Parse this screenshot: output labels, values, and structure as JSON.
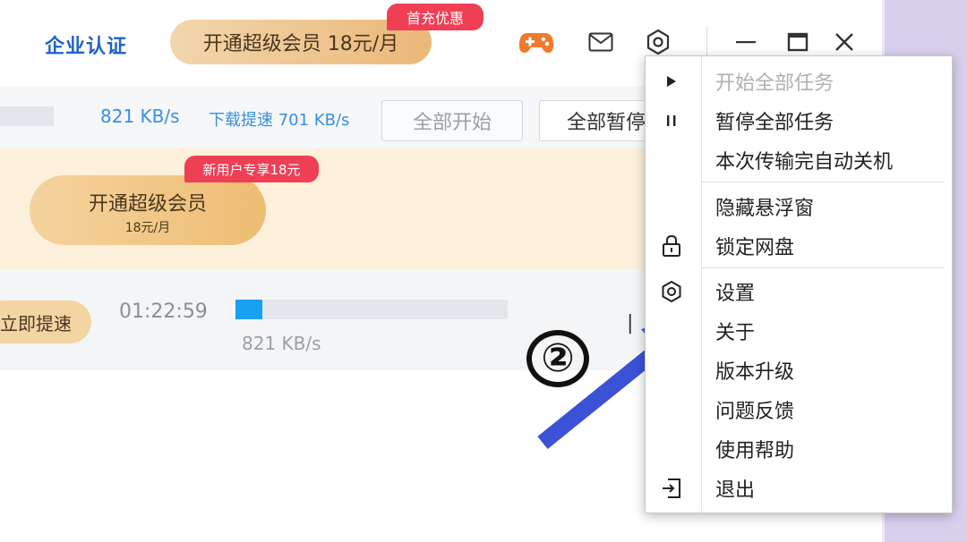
{
  "header": {
    "enterprise_label": "企业认证",
    "vip_label": "开通超级会员 18元/月",
    "first_charge_badge": "首充优惠"
  },
  "toolbar": {
    "speed": "821 KB/s",
    "boost_label": "下载提速 701 KB/s",
    "start_all": "全部开始",
    "pause_all": "全部暂停"
  },
  "promo": {
    "new_user_badge": "新用户专享18元",
    "vip_title": "开通超级会员",
    "vip_price": "18元/月"
  },
  "task": {
    "boost_button": "立即提速",
    "remaining_time": "01:22:59",
    "speed": "821 KB/s",
    "progress_fraction": 0.1
  },
  "annotation": {
    "step": "②"
  },
  "menu": {
    "items": [
      {
        "label": "开始全部任务",
        "icon": "play-icon",
        "disabled": true
      },
      {
        "label": "暂停全部任务",
        "icon": "pause-icon",
        "disabled": false
      },
      {
        "label": "本次传输完自动关机",
        "icon": "",
        "disabled": false
      },
      {
        "label": "隐藏悬浮窗",
        "icon": "",
        "disabled": false
      },
      {
        "label": "锁定网盘",
        "icon": "lock-icon",
        "disabled": false
      },
      {
        "label": "设置",
        "icon": "gear-icon",
        "disabled": false
      },
      {
        "label": "关于",
        "icon": "",
        "disabled": false
      },
      {
        "label": "版本升级",
        "icon": "",
        "disabled": false
      },
      {
        "label": "问题反馈",
        "icon": "",
        "disabled": false
      },
      {
        "label": "使用帮助",
        "icon": "",
        "disabled": false
      },
      {
        "label": "退出",
        "icon": "exit-icon",
        "disabled": false
      }
    ]
  },
  "colors": {
    "accent_blue": "#1f63c6",
    "badge_red": "#ee3f55",
    "arrow_blue": "#3b52d6",
    "progress_blue": "#1aa0f0"
  }
}
